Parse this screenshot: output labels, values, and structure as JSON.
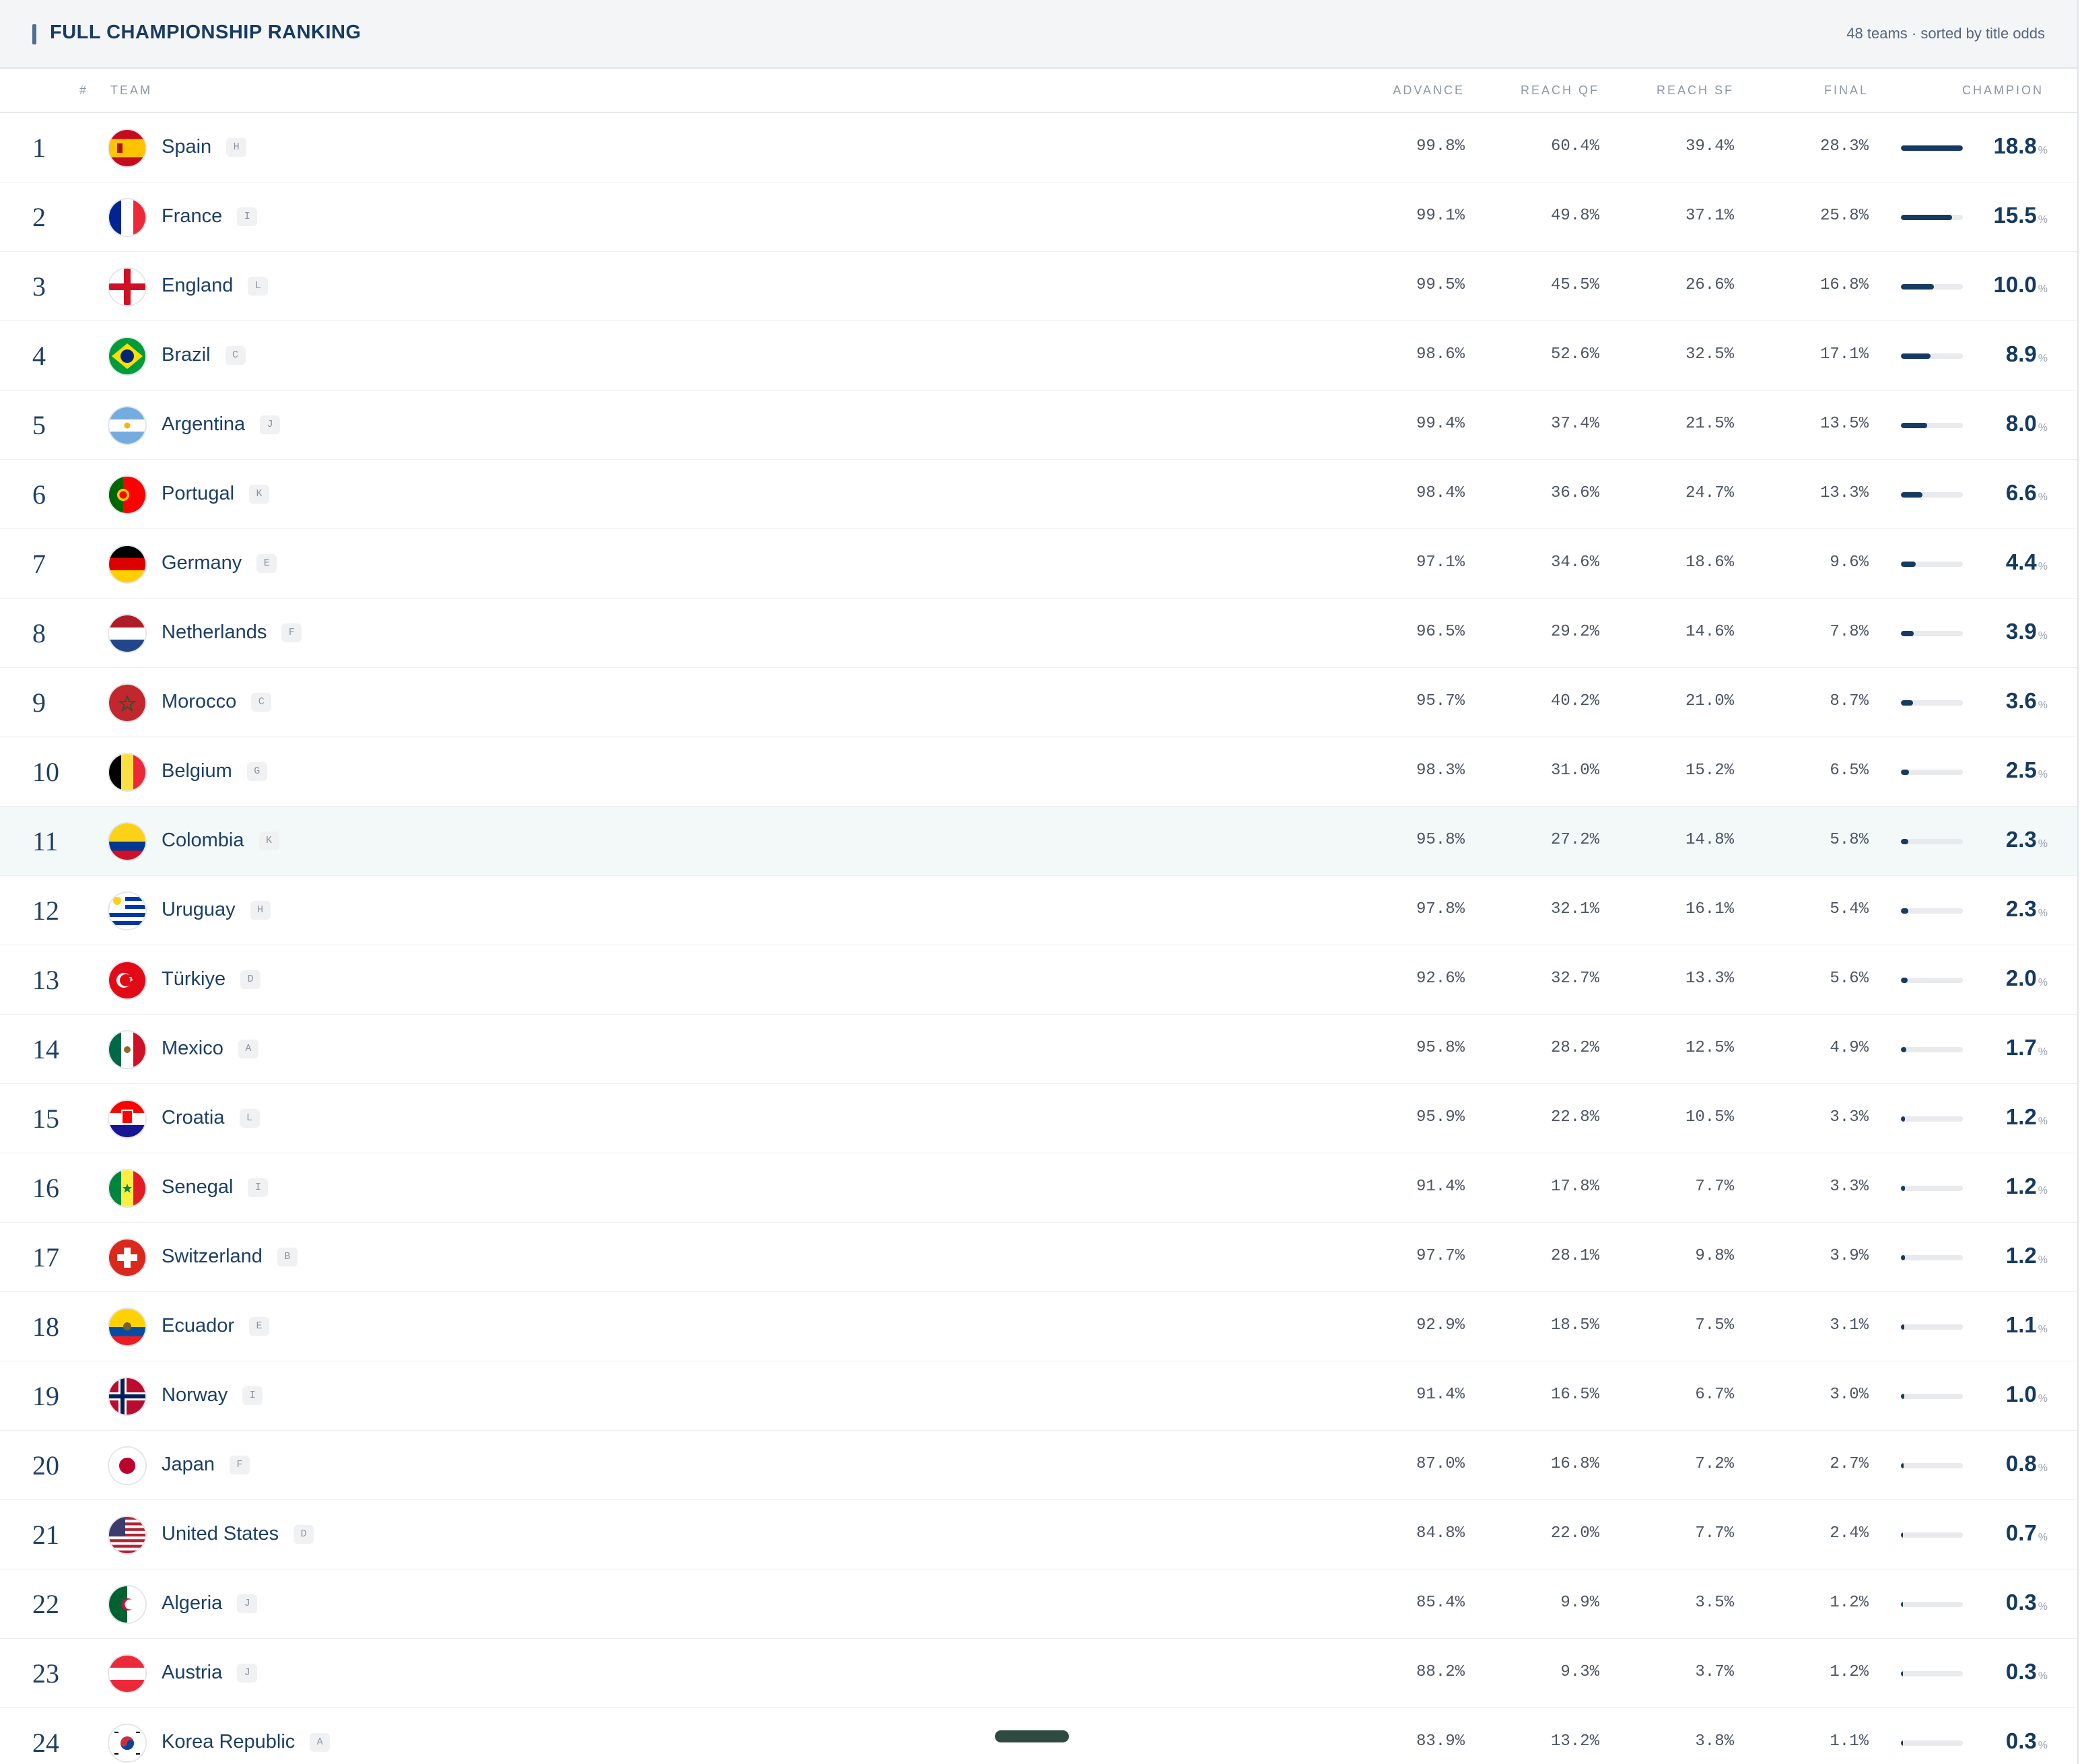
{
  "header": {
    "title": "FULL CHAMPIONSHIP RANKING",
    "meta": "48 teams · sorted by title odds"
  },
  "columns": {
    "rank": "#",
    "team": "TEAM",
    "advance": "ADVANCE",
    "reach_qf": "REACH QF",
    "reach_sf": "REACH SF",
    "final": "FINAL",
    "champion": "CHAMPION"
  },
  "percent_suffix": "%",
  "colors": {
    "navy": "#163b62",
    "highlight_row": "#f3f8f9",
    "bar_track": "#e8eaed"
  },
  "rows": [
    {
      "rank": "1",
      "team": "Spain",
      "group": "H",
      "advance": "99.8%",
      "reach_qf": "60.4%",
      "reach_sf": "39.4%",
      "final": "28.3%",
      "champion": "18.8",
      "champion_value": 18.8,
      "flag": "spain-flag-icon"
    },
    {
      "rank": "2",
      "team": "France",
      "group": "I",
      "advance": "99.1%",
      "reach_qf": "49.8%",
      "reach_sf": "37.1%",
      "final": "25.8%",
      "champion": "15.5",
      "champion_value": 15.5,
      "flag": "france-flag-icon"
    },
    {
      "rank": "3",
      "team": "England",
      "group": "L",
      "advance": "99.5%",
      "reach_qf": "45.5%",
      "reach_sf": "26.6%",
      "final": "16.8%",
      "champion": "10.0",
      "champion_value": 10.0,
      "flag": "england-flag-icon"
    },
    {
      "rank": "4",
      "team": "Brazil",
      "group": "C",
      "advance": "98.6%",
      "reach_qf": "52.6%",
      "reach_sf": "32.5%",
      "final": "17.1%",
      "champion": "8.9",
      "champion_value": 8.9,
      "flag": "brazil-flag-icon"
    },
    {
      "rank": "5",
      "team": "Argentina",
      "group": "J",
      "advance": "99.4%",
      "reach_qf": "37.4%",
      "reach_sf": "21.5%",
      "final": "13.5%",
      "champion": "8.0",
      "champion_value": 8.0,
      "flag": "argentina-flag-icon"
    },
    {
      "rank": "6",
      "team": "Portugal",
      "group": "K",
      "advance": "98.4%",
      "reach_qf": "36.6%",
      "reach_sf": "24.7%",
      "final": "13.3%",
      "champion": "6.6",
      "champion_value": 6.6,
      "flag": "portugal-flag-icon"
    },
    {
      "rank": "7",
      "team": "Germany",
      "group": "E",
      "advance": "97.1%",
      "reach_qf": "34.6%",
      "reach_sf": "18.6%",
      "final": "9.6%",
      "champion": "4.4",
      "champion_value": 4.4,
      "flag": "germany-flag-icon"
    },
    {
      "rank": "8",
      "team": "Netherlands",
      "group": "F",
      "advance": "96.5%",
      "reach_qf": "29.2%",
      "reach_sf": "14.6%",
      "final": "7.8%",
      "champion": "3.9",
      "champion_value": 3.9,
      "flag": "netherlands-flag-icon"
    },
    {
      "rank": "9",
      "team": "Morocco",
      "group": "C",
      "advance": "95.7%",
      "reach_qf": "40.2%",
      "reach_sf": "21.0%",
      "final": "8.7%",
      "champion": "3.6",
      "champion_value": 3.6,
      "flag": "morocco-flag-icon"
    },
    {
      "rank": "10",
      "team": "Belgium",
      "group": "G",
      "advance": "98.3%",
      "reach_qf": "31.0%",
      "reach_sf": "15.2%",
      "final": "6.5%",
      "champion": "2.5",
      "champion_value": 2.5,
      "flag": "belgium-flag-icon"
    },
    {
      "rank": "11",
      "team": "Colombia",
      "group": "K",
      "advance": "95.8%",
      "reach_qf": "27.2%",
      "reach_sf": "14.8%",
      "final": "5.8%",
      "champion": "2.3",
      "champion_value": 2.3,
      "flag": "colombia-flag-icon",
      "highlighted": true
    },
    {
      "rank": "12",
      "team": "Uruguay",
      "group": "H",
      "advance": "97.8%",
      "reach_qf": "32.1%",
      "reach_sf": "16.1%",
      "final": "5.4%",
      "champion": "2.3",
      "champion_value": 2.3,
      "flag": "uruguay-flag-icon"
    },
    {
      "rank": "13",
      "team": "Türkiye",
      "group": "D",
      "advance": "92.6%",
      "reach_qf": "32.7%",
      "reach_sf": "13.3%",
      "final": "5.6%",
      "champion": "2.0",
      "champion_value": 2.0,
      "flag": "turkiye-flag-icon"
    },
    {
      "rank": "14",
      "team": "Mexico",
      "group": "A",
      "advance": "95.8%",
      "reach_qf": "28.2%",
      "reach_sf": "12.5%",
      "final": "4.9%",
      "champion": "1.7",
      "champion_value": 1.7,
      "flag": "mexico-flag-icon"
    },
    {
      "rank": "15",
      "team": "Croatia",
      "group": "L",
      "advance": "95.9%",
      "reach_qf": "22.8%",
      "reach_sf": "10.5%",
      "final": "3.3%",
      "champion": "1.2",
      "champion_value": 1.2,
      "flag": "croatia-flag-icon"
    },
    {
      "rank": "16",
      "team": "Senegal",
      "group": "I",
      "advance": "91.4%",
      "reach_qf": "17.8%",
      "reach_sf": "7.7%",
      "final": "3.3%",
      "champion": "1.2",
      "champion_value": 1.2,
      "flag": "senegal-flag-icon"
    },
    {
      "rank": "17",
      "team": "Switzerland",
      "group": "B",
      "advance": "97.7%",
      "reach_qf": "28.1%",
      "reach_sf": "9.8%",
      "final": "3.9%",
      "champion": "1.2",
      "champion_value": 1.2,
      "flag": "switzerland-flag-icon"
    },
    {
      "rank": "18",
      "team": "Ecuador",
      "group": "E",
      "advance": "92.9%",
      "reach_qf": "18.5%",
      "reach_sf": "7.5%",
      "final": "3.1%",
      "champion": "1.1",
      "champion_value": 1.1,
      "flag": "ecuador-flag-icon"
    },
    {
      "rank": "19",
      "team": "Norway",
      "group": "I",
      "advance": "91.4%",
      "reach_qf": "16.5%",
      "reach_sf": "6.7%",
      "final": "3.0%",
      "champion": "1.0",
      "champion_value": 1.0,
      "flag": "norway-flag-icon"
    },
    {
      "rank": "20",
      "team": "Japan",
      "group": "F",
      "advance": "87.0%",
      "reach_qf": "16.8%",
      "reach_sf": "7.2%",
      "final": "2.7%",
      "champion": "0.8",
      "champion_value": 0.8,
      "flag": "japan-flag-icon"
    },
    {
      "rank": "21",
      "team": "United States",
      "group": "D",
      "advance": "84.8%",
      "reach_qf": "22.0%",
      "reach_sf": "7.7%",
      "final": "2.4%",
      "champion": "0.7",
      "champion_value": 0.7,
      "flag": "usa-flag-icon"
    },
    {
      "rank": "22",
      "team": "Algeria",
      "group": "J",
      "advance": "85.4%",
      "reach_qf": "9.9%",
      "reach_sf": "3.5%",
      "final": "1.2%",
      "champion": "0.3",
      "champion_value": 0.3,
      "flag": "algeria-flag-icon"
    },
    {
      "rank": "23",
      "team": "Austria",
      "group": "J",
      "advance": "88.2%",
      "reach_qf": "9.3%",
      "reach_sf": "3.7%",
      "final": "1.2%",
      "champion": "0.3",
      "champion_value": 0.3,
      "flag": "austria-flag-icon"
    },
    {
      "rank": "24",
      "team": "Korea Republic",
      "group": "A",
      "advance": "83.9%",
      "reach_qf": "13.2%",
      "reach_sf": "3.8%",
      "final": "1.1%",
      "champion": "0.3",
      "champion_value": 0.3,
      "flag": "korea-flag-icon"
    }
  ]
}
